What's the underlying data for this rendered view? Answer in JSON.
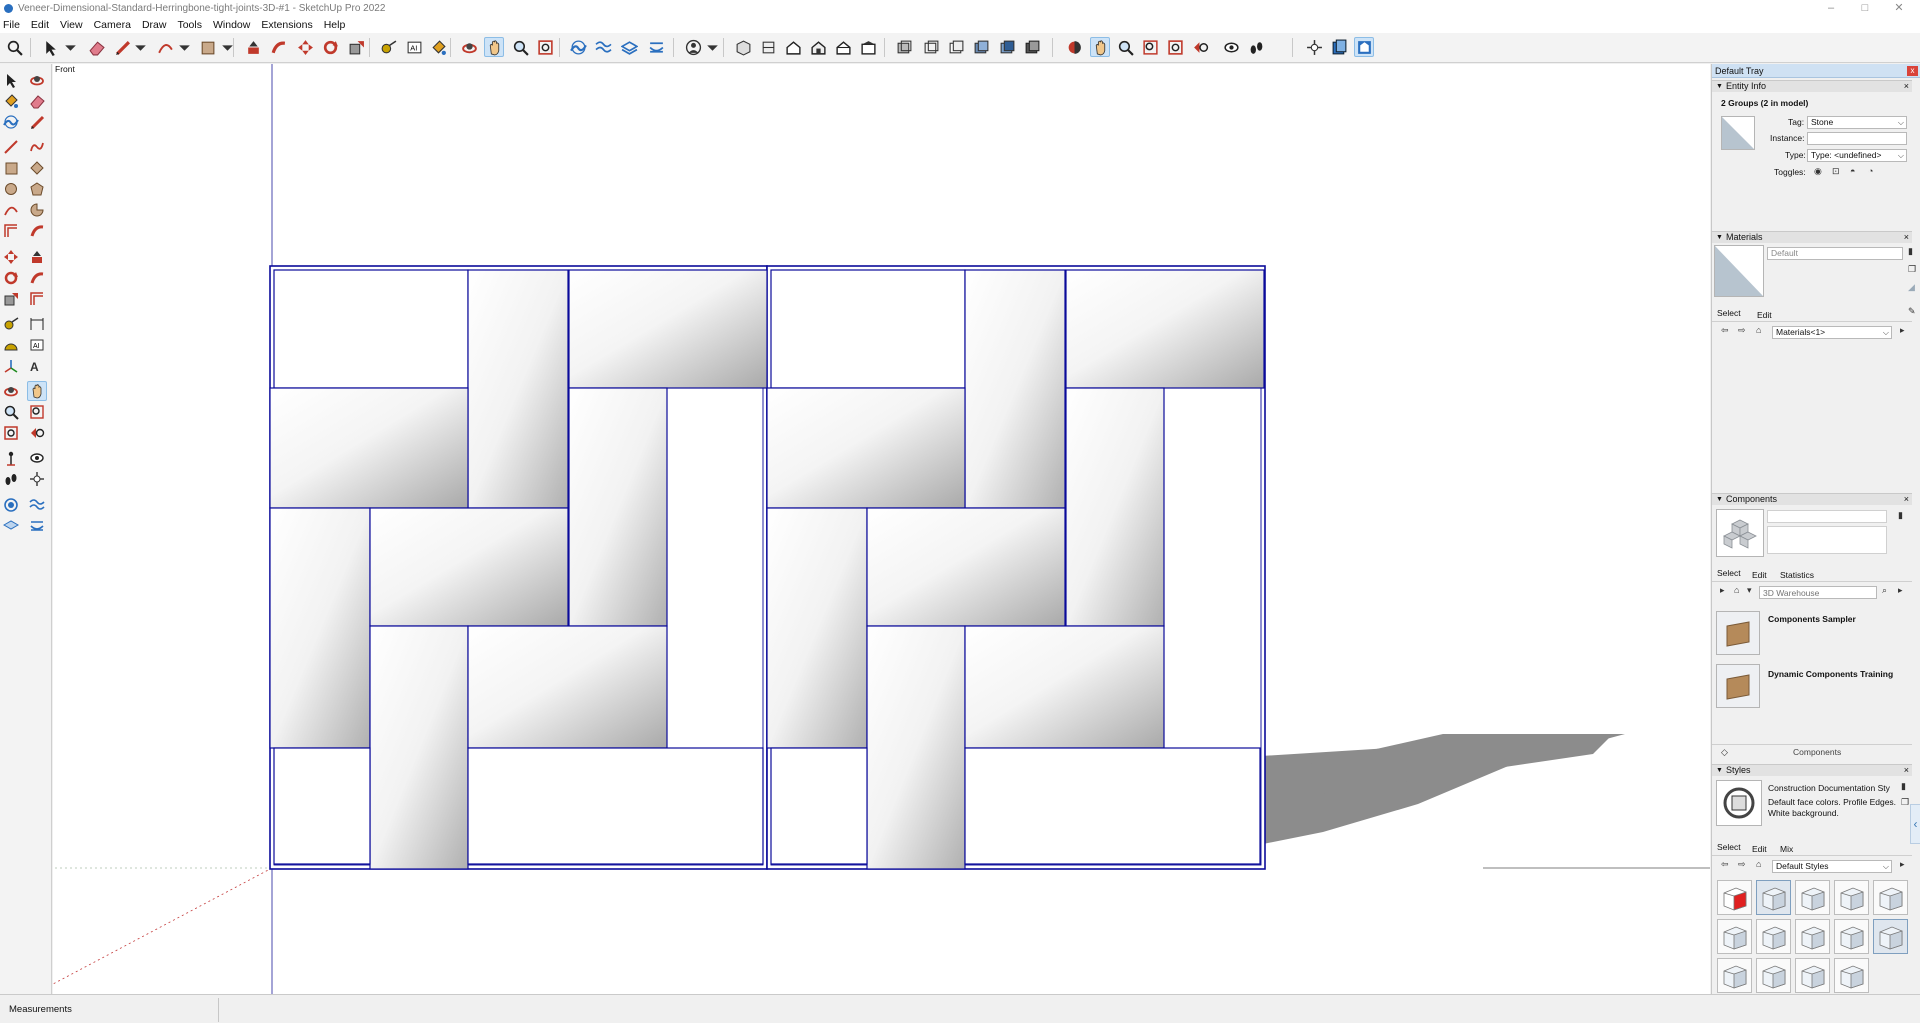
{
  "window": {
    "title": "Veneer-Dimensional-Standard-Herringbone-tight-joints-3D-#1 - SketchUp Pro 2022",
    "controls": {
      "minimize": "–",
      "maximize": "□",
      "close": "✕"
    }
  },
  "menu": [
    "File",
    "Edit",
    "View",
    "Camera",
    "Draw",
    "Tools",
    "Window",
    "Extensions",
    "Help"
  ],
  "viewport": {
    "scene_label": "Front"
  },
  "tray": {
    "title": "Default Tray",
    "close": "x",
    "entity_info": {
      "header": "Entity Info",
      "selection": "2 Groups (2 in model)",
      "tag_label": "Tag:",
      "tag_value": "Stone",
      "instance_label": "Instance:",
      "instance_value": "",
      "type_label": "Type:",
      "type_value": "Type: <undefined>",
      "toggles_label": "Toggles:"
    },
    "materials": {
      "header": "Materials",
      "current": "Default",
      "tab_select": "Select",
      "tab_edit": "Edit",
      "collection": "Materials<1>"
    },
    "components": {
      "header": "Components",
      "tab_select": "Select",
      "tab_edit": "Edit",
      "tab_statistics": "Statistics",
      "search_placeholder": "3D Warehouse",
      "items": [
        "Components Sampler",
        "Dynamic Components Training"
      ],
      "footer": "Components"
    },
    "styles": {
      "header": "Styles",
      "current_name": "Construction Documentation Sty",
      "current_desc": "Default face colors. Profile Edges. White background.",
      "tab_select": "Select",
      "tab_edit": "Edit",
      "tab_mix": "Mix",
      "collection": "Default Styles"
    }
  },
  "status": {
    "measurements_label": "Measurements"
  },
  "colors": {
    "selection_blue": "#0b0b9a",
    "axis_green": "#1e8a1e",
    "axis_red": "#c43a3a",
    "shadow": "#8c8c8c",
    "active_tool": "#cde3f7"
  },
  "icons": {
    "toolbar": [
      "search-icon",
      "select-arrow-icon",
      "dropdown-icon",
      "eraser-icon",
      "pencil-icon",
      "dropdown-icon",
      "arc-icon",
      "dropdown-icon",
      "rectangle-icon",
      "dropdown-icon",
      "push-pull-icon",
      "follow-me-icon",
      "move-icon",
      "rotate-icon",
      "scale-icon",
      "tape-measure-icon",
      "text-icon",
      "paint-bucket-icon",
      "orbit-icon",
      "pan-icon",
      "zoom-icon",
      "zoom-extents-icon",
      "sandbox-icon",
      "smoove-icon",
      "stamp-icon",
      "drape-icon",
      "user-icon",
      "dropdown-icon",
      "iso-view-icon",
      "top-view-icon",
      "front-view-icon",
      "right-view-icon",
      "back-view-icon",
      "left-view-icon",
      "xray-icon",
      "wireframe-icon",
      "hidden-line-icon",
      "shaded-icon",
      "textured-icon",
      "monochrome-icon",
      "section-plane-icon",
      "orbit-icon",
      "zoom-icon",
      "zoom-window-icon",
      "zoom-extents-icon",
      "previous-view-icon",
      "look-around-icon",
      "walk-icon",
      "position-camera-icon",
      "component-options-icon",
      "generate-report-icon",
      "warehouse-icon"
    ]
  }
}
